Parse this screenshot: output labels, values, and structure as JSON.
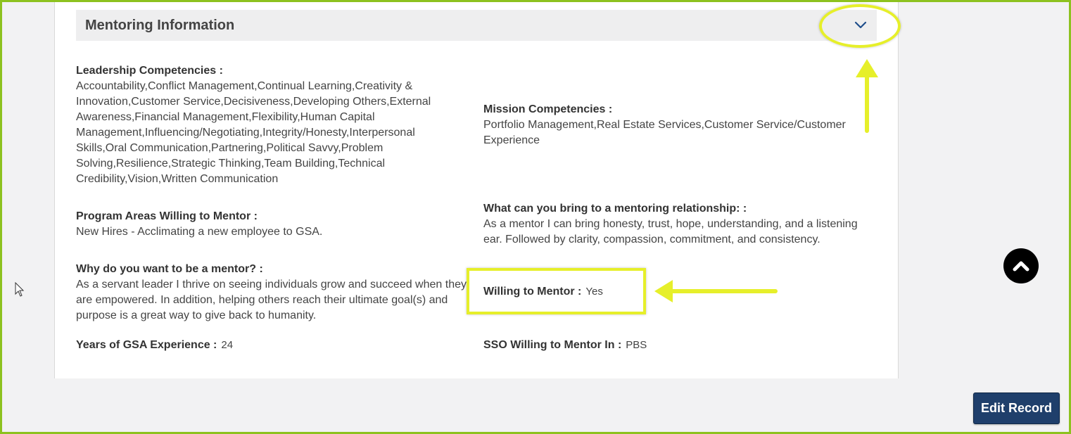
{
  "section": {
    "title": "Mentoring Information"
  },
  "fields": {
    "leadership": {
      "label": "Leadership Competencies :",
      "value": "Accountability,Conflict Management,Continual Learning,Creativity & Innovation,Customer Service,Decisiveness,Developing Others,External Awareness,Financial Management,Flexibility,Human Capital Management,Influencing/Negotiating,Integrity/Honesty,Interpersonal Skills,Oral Communication,Partnering,Political Savvy,Problem Solving,Resilience,Strategic Thinking,Team Building,Technical Credibility,Vision,Written Communication"
    },
    "mission": {
      "label": "Mission Competencies :",
      "value": "Portfolio Management,Real Estate Services,Customer Service/Customer Experience"
    },
    "program_areas": {
      "label": "Program Areas Willing to Mentor :",
      "value": "New Hires - Acclimating a new employee to GSA."
    },
    "bring": {
      "label": "What can you bring to a mentoring relationship: :",
      "value": "As a mentor I can bring honesty, trust, hope, understanding, and a listening ear. Followed by clarity, compassion, commitment, and consistency."
    },
    "why": {
      "label": "Why do you want to be a mentor? :",
      "value": "As a servant leader I thrive on seeing individuals grow and succeed when they are empowered. In addition, helping others reach their ultimate goal(s) and purpose is a great way to give back to humanity."
    },
    "willing": {
      "label": "Willing to Mentor :",
      "value": "Yes"
    },
    "years": {
      "label": "Years of GSA Experience :",
      "value": "24"
    },
    "sso": {
      "label": "SSO Willing to Mentor In :",
      "value": "PBS"
    }
  },
  "buttons": {
    "edit_record": "Edit Record"
  },
  "icons": {
    "collapse": "chevron-down-icon",
    "scroll_top": "chevron-up-icon",
    "cursor": "mouse-pointer-icon"
  },
  "colors": {
    "highlight": "#e6ef2a",
    "frame": "#8dc21f",
    "button": "#1f3f6b",
    "chevron": "#1f4e8c"
  }
}
